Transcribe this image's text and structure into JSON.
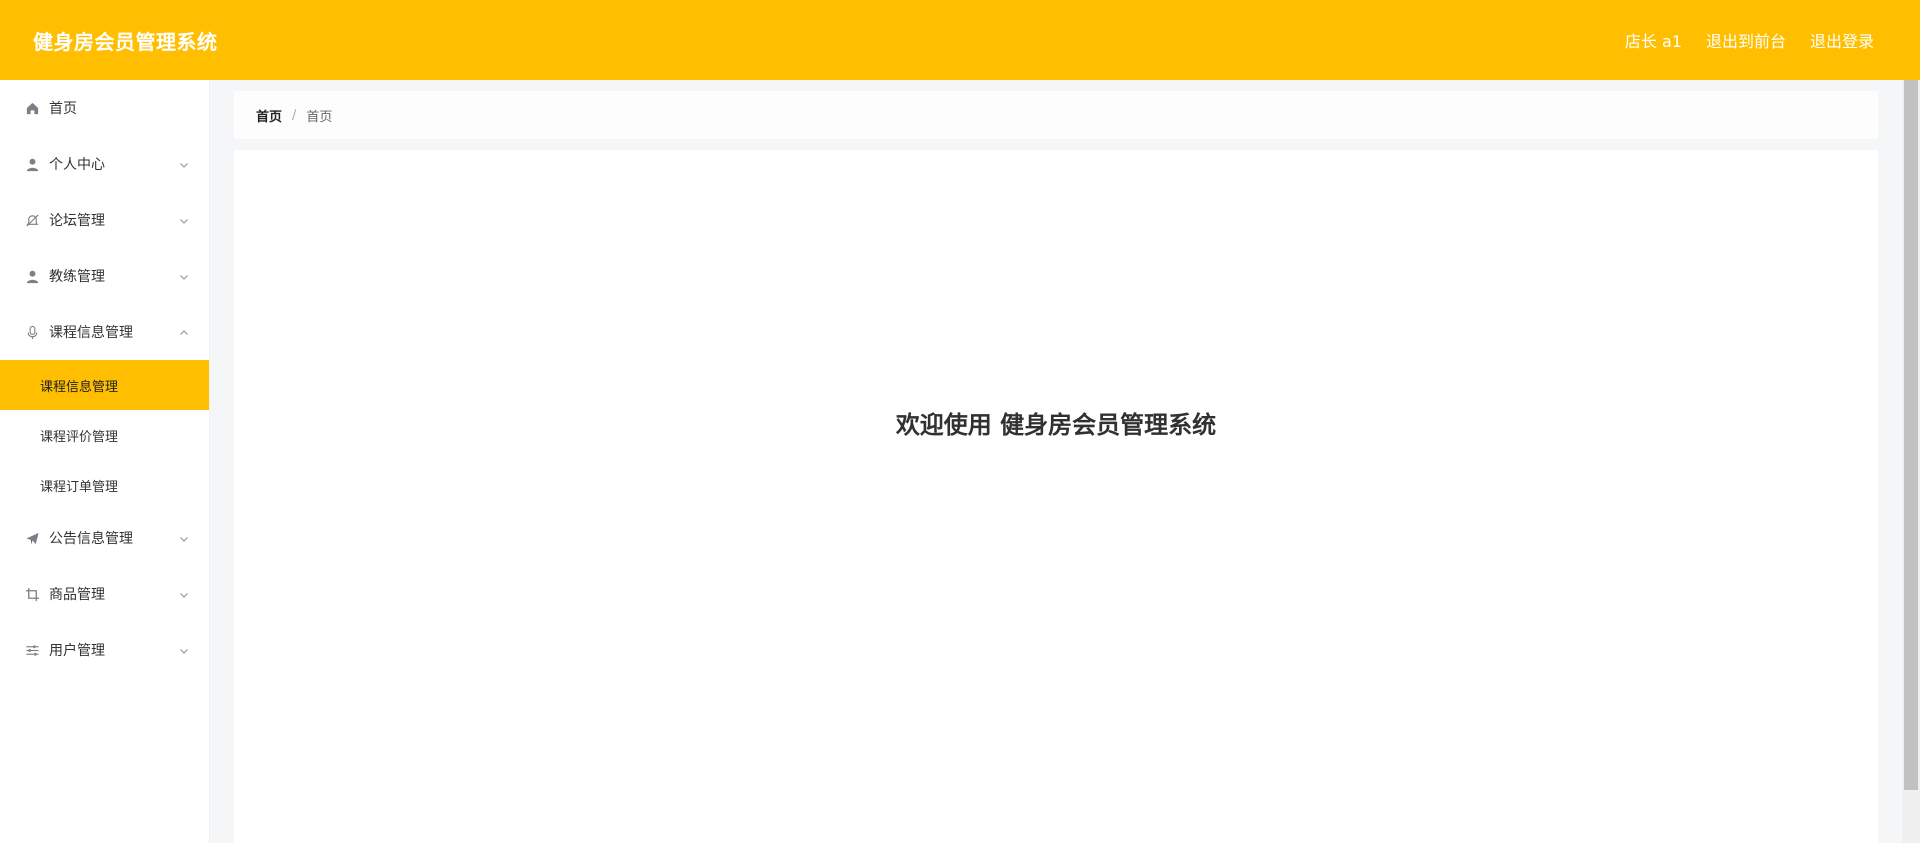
{
  "header": {
    "title": "健身房会员管理系统",
    "user_label": "店长 a1",
    "front_link": "退出到前台",
    "logout_link": "退出登录"
  },
  "sidebar": {
    "items": [
      {
        "label": "首页",
        "icon": "home-icon"
      },
      {
        "label": "个人中心",
        "icon": "user-icon"
      },
      {
        "label": "论坛管理",
        "icon": "bell-off-icon"
      },
      {
        "label": "教练管理",
        "icon": "person-icon"
      },
      {
        "label": "课程信息管理",
        "icon": "microphone-icon"
      },
      {
        "label": "公告信息管理",
        "icon": "paper-plane-icon"
      },
      {
        "label": "商品管理",
        "icon": "crop-icon"
      },
      {
        "label": "用户管理",
        "icon": "sliders-icon"
      }
    ],
    "course_submenu": [
      {
        "label": "课程信息管理",
        "active": true
      },
      {
        "label": "课程评价管理",
        "active": false
      },
      {
        "label": "课程订单管理",
        "active": false
      }
    ]
  },
  "breadcrumb": {
    "first": "首页",
    "separator": "/",
    "current": "首页"
  },
  "main": {
    "welcome": "欢迎使用 健身房会员管理系统"
  },
  "colors": {
    "accent": "#ffbf00",
    "sidebar_bg": "#ffffff",
    "page_bg": "#f5f6f8"
  }
}
